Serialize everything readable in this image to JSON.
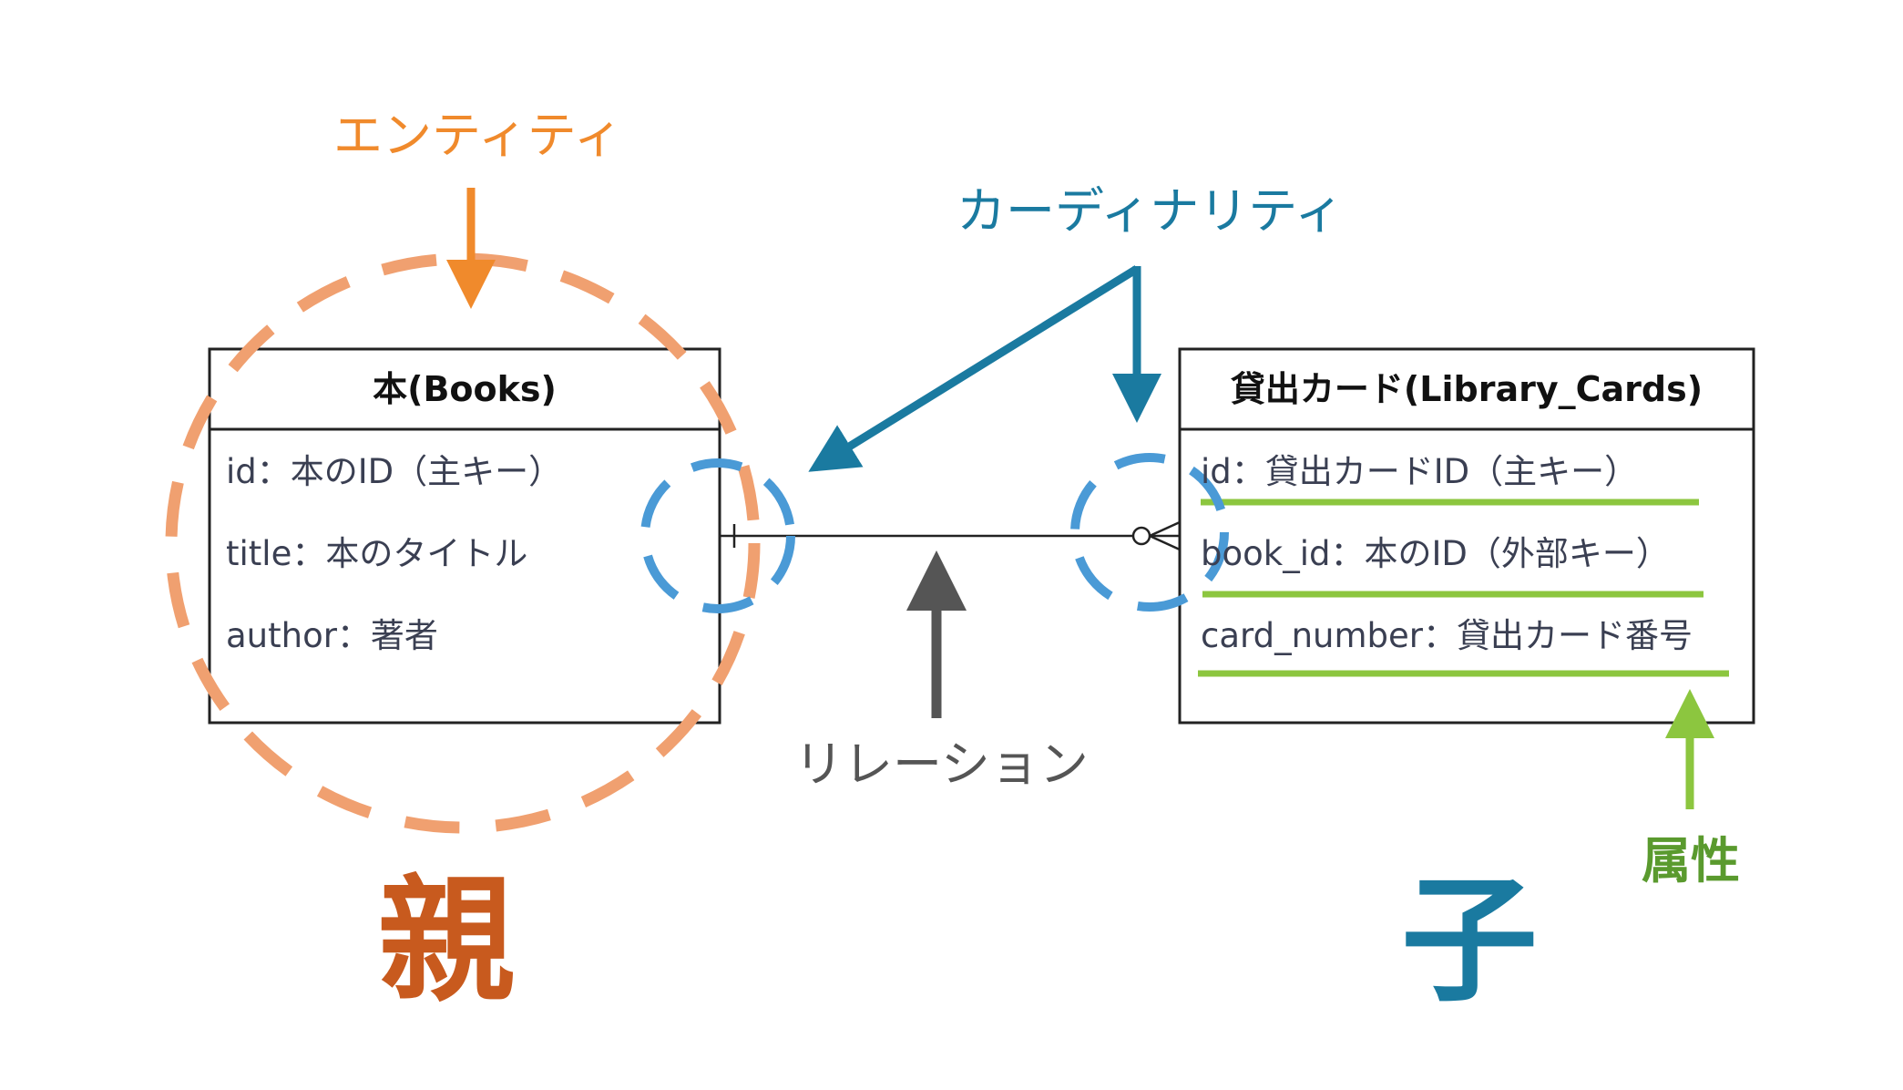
{
  "labels": {
    "entity": "エンティティ",
    "cardinality": "カーディナリティ",
    "relation": "リレーション",
    "attribute": "属性",
    "parent": "親",
    "child": "子"
  },
  "books": {
    "title": "本(Books)",
    "attributes": [
      "id：本のID（主キー）",
      "title：本のタイトル",
      "author：著者"
    ]
  },
  "cards": {
    "title": "貸出カード(Library_Cards)",
    "attributes": [
      "id：貸出カードID（主キー）",
      "book_id：本のID（外部キー）",
      "card_number：貸出カード番号"
    ]
  },
  "colors": {
    "entity_orange": "#f08a2c",
    "entity_circle": "#f0a070",
    "cardinality_blue": "#1a7aa0",
    "cardinality_circle": "#4a9ad6",
    "relation_gray": "#555555",
    "attribute_green": "#8cc63f",
    "parent_text": "#c85a1e"
  }
}
